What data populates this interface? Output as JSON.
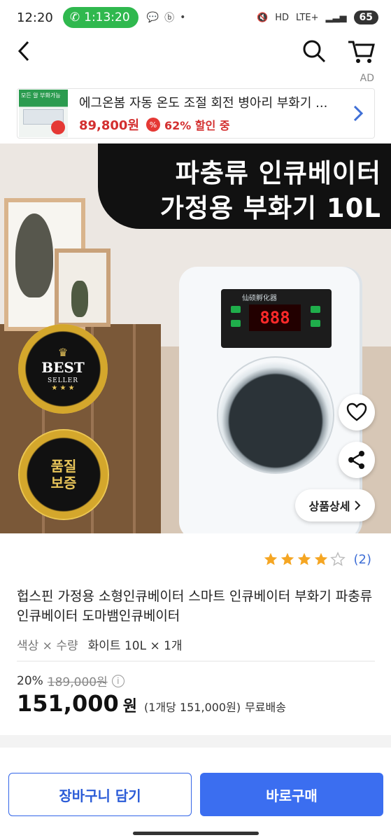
{
  "status_bar": {
    "time": "12:20",
    "call_duration": "1:13:20",
    "icons": [
      "talk-icon",
      "b-icon",
      "dot-icon"
    ],
    "network": "LTE+",
    "hd": "HD",
    "battery": "65"
  },
  "header": {
    "back_icon": "chevron-left-icon",
    "search_icon": "search-icon",
    "cart_icon": "cart-icon"
  },
  "ad": {
    "label": "AD",
    "thumb_text": "모든 알 부화가능",
    "title": "에그온봄 자동 온도 조절 회전 병아리 부화기 ...",
    "price": "89,800원",
    "discount_badge": "%",
    "discount": "62% 할인 중"
  },
  "image": {
    "title_line1": "파충류 인큐베이터",
    "title_line2": "가정용 부화기 10L",
    "panel_label": "仙硕孵化器",
    "display": "888",
    "badge_best": "BEST",
    "badge_best_sub": "SELLER",
    "badge_quality_line1": "품질",
    "badge_quality_line2": "보증",
    "detail_button": "상품상세",
    "heart_icon": "heart-icon",
    "share_icon": "share-icon"
  },
  "product": {
    "rating": 4,
    "rating_max": 5,
    "review_count": "(2)",
    "name": "헙스핀 가정용 소형인큐베이터 스마트 인큐베이터 부화기 파충류인큐베이터 도마뱀인큐베이터",
    "option_label": "색상 × 수량",
    "option_value": "화이트 10L × 1개",
    "discount_rate": "20%",
    "original_price": "189,000원",
    "price": "151,000",
    "price_unit": "원",
    "unit_price": "(1개당 151,000원)",
    "shipping": "무료배송"
  },
  "actions": {
    "cart": "장바구니 담기",
    "buy": "바로구매"
  },
  "colors": {
    "accent": "#3b6ef0",
    "price_red": "#d32f2f",
    "star": "#f5a623",
    "call_green": "#2fb84e"
  }
}
